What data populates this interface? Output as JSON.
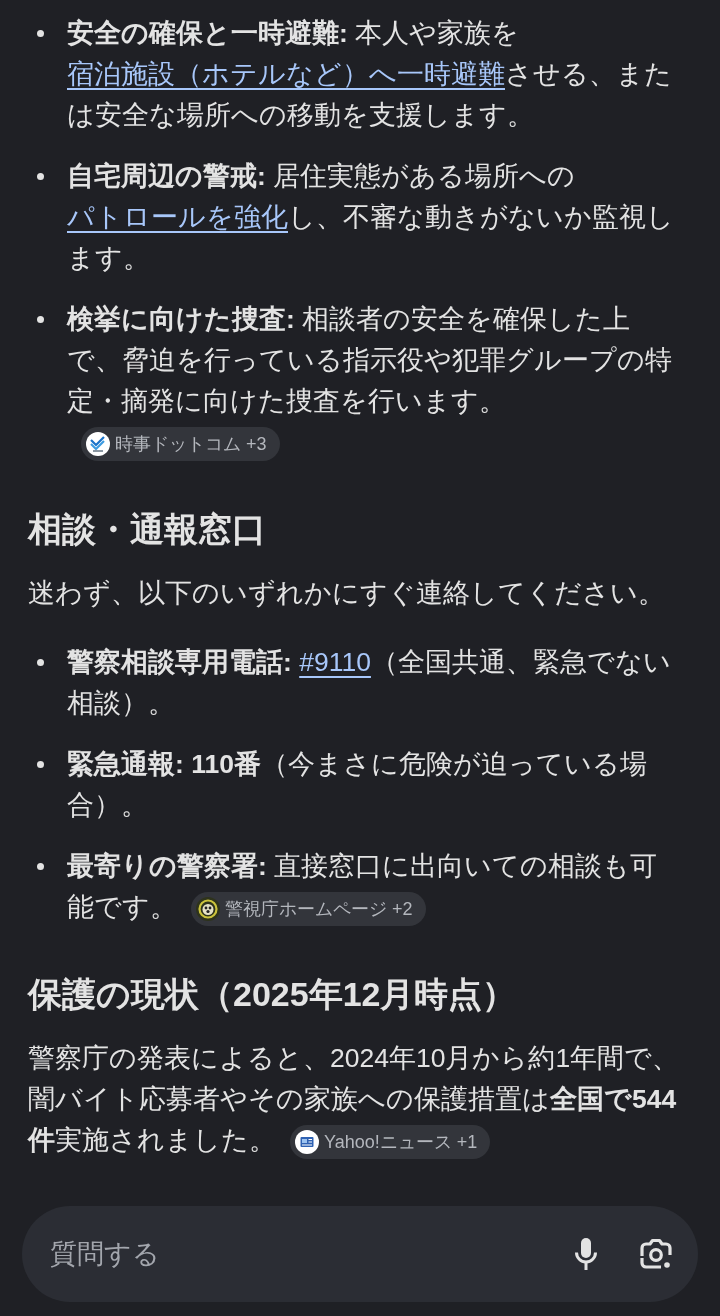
{
  "blocks": [
    {
      "kind": "list",
      "items": [
        {
          "segments": [
            {
              "kind": "text",
              "text": "**安全の確保と一時避難:** 本人や家族を"
            },
            {
              "kind": "link",
              "text": "宿泊施設（ホテルなど）へ一時避難"
            },
            {
              "kind": "text",
              "text": "させる、または安全な場所への移動を支援します。"
            }
          ]
        },
        {
          "segments": [
            {
              "kind": "text",
              "text": "**自宅周辺の警戒:** 居住実態がある場所への"
            },
            {
              "kind": "link",
              "text": "パトロールを強化"
            },
            {
              "kind": "text",
              "text": "し、不審な動きがないか監視します。"
            }
          ]
        },
        {
          "segments": [
            {
              "kind": "text",
              "text": "**検挙に向けた捜査:** 相談者の安全を確保した上で、脅迫を行っている指示役や犯罪グループの特定・摘発に向けた捜査を行います。"
            }
          ],
          "source": {
            "label": "時事ドットコム +3"
          }
        }
      ]
    },
    {
      "kind": "heading",
      "text": "相談・通報窓口"
    },
    {
      "kind": "paragraph",
      "segments": [
        {
          "kind": "text",
          "text": "迷わず、以下のいずれかにすぐ連絡してください。"
        }
      ]
    },
    {
      "kind": "list",
      "items": [
        {
          "segments": [
            {
              "kind": "text",
              "text": "**警察相談専用電話:** "
            },
            {
              "kind": "link",
              "text": "#9110"
            },
            {
              "kind": "text",
              "text": "（全国共通、緊急でない相談）。"
            }
          ]
        },
        {
          "segments": [
            {
              "kind": "text",
              "text": "**緊急通報: 110番**（今まさに危険が迫っている場合）。"
            }
          ]
        },
        {
          "segments": [
            {
              "kind": "text",
              "text": "**最寄りの警察署:** 直接窓口に出向いての相談も可能です。"
            }
          ],
          "source": {
            "label": "警視庁ホームページ +2"
          }
        }
      ]
    },
    {
      "kind": "heading",
      "text": "保護の現状（2025年12月時点）"
    },
    {
      "kind": "paragraph",
      "segments": [
        {
          "kind": "text",
          "text": "警察庁の発表によると、2024年10月から約1年間で、闇バイト応募者やその家族への保護措置は**全国で544件**実施されました。"
        }
      ],
      "source": {
        "label": "Yahoo!ニュース +1"
      }
    }
  ],
  "input_bar": {
    "placeholder": "質問する"
  }
}
